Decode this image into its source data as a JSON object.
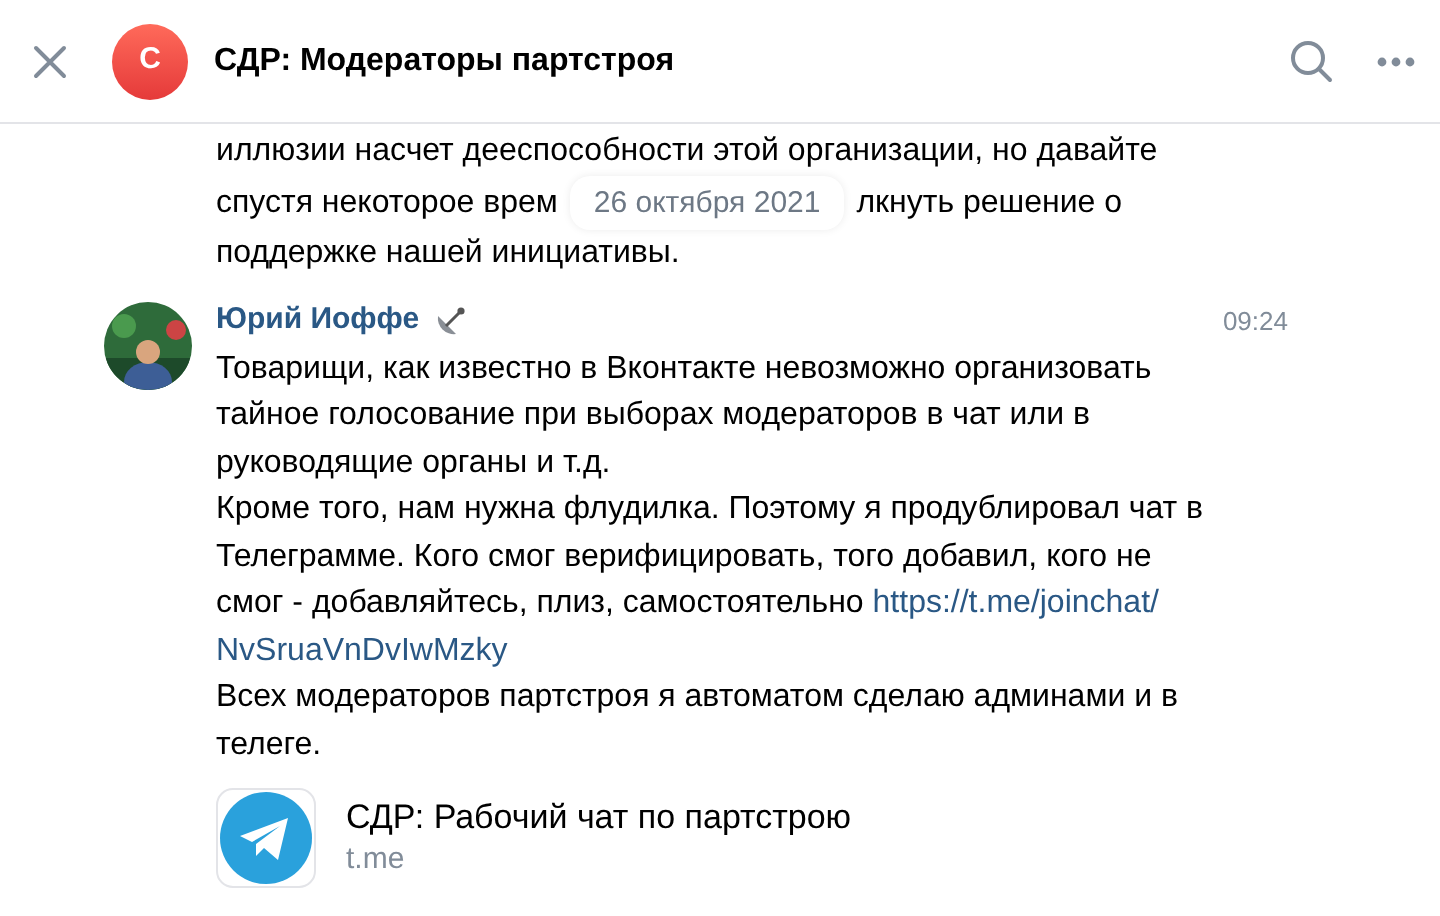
{
  "header": {
    "avatar_letter": "С",
    "title": "СДР: Модераторы партстроя"
  },
  "previous_message": {
    "line_1": "иллюзии насчет дееспособности этой организации, но давайте",
    "line_2_start": "спустя некоторое врем",
    "line_2_end": "лкнуть решение о",
    "line_3": "поддержке нашей инициативы."
  },
  "date_badge": "26 октября 2021",
  "message": {
    "author": "Юрий Иоффе",
    "time": "09:24",
    "paragraphs": [
      {
        "kind": "text",
        "text": "Товарищи, как известно в Вконтакте невозможно организовать тайное голосование при выборах модераторов в чат или в руководящие органы и т.д."
      },
      {
        "kind": "text_with_link",
        "text": "Кроме того, нам нужна флудилка. Поэтому я продублировал чат в Телеграмме. Кого смог верифицировать, того добавил, кого не смог - добавляйтесь, плиз, самостоятельно",
        "link_line_1": "https://t.me/joinchat/",
        "link_line_2": "NvSruaVnDvIwMzky"
      },
      {
        "kind": "text",
        "text": "Всех модераторов партстроя я автоматом сделаю админами и в телеге."
      }
    ],
    "attachment": {
      "title": "СДР: Рабочий чат по партстрою",
      "domain": "t.me"
    }
  }
}
